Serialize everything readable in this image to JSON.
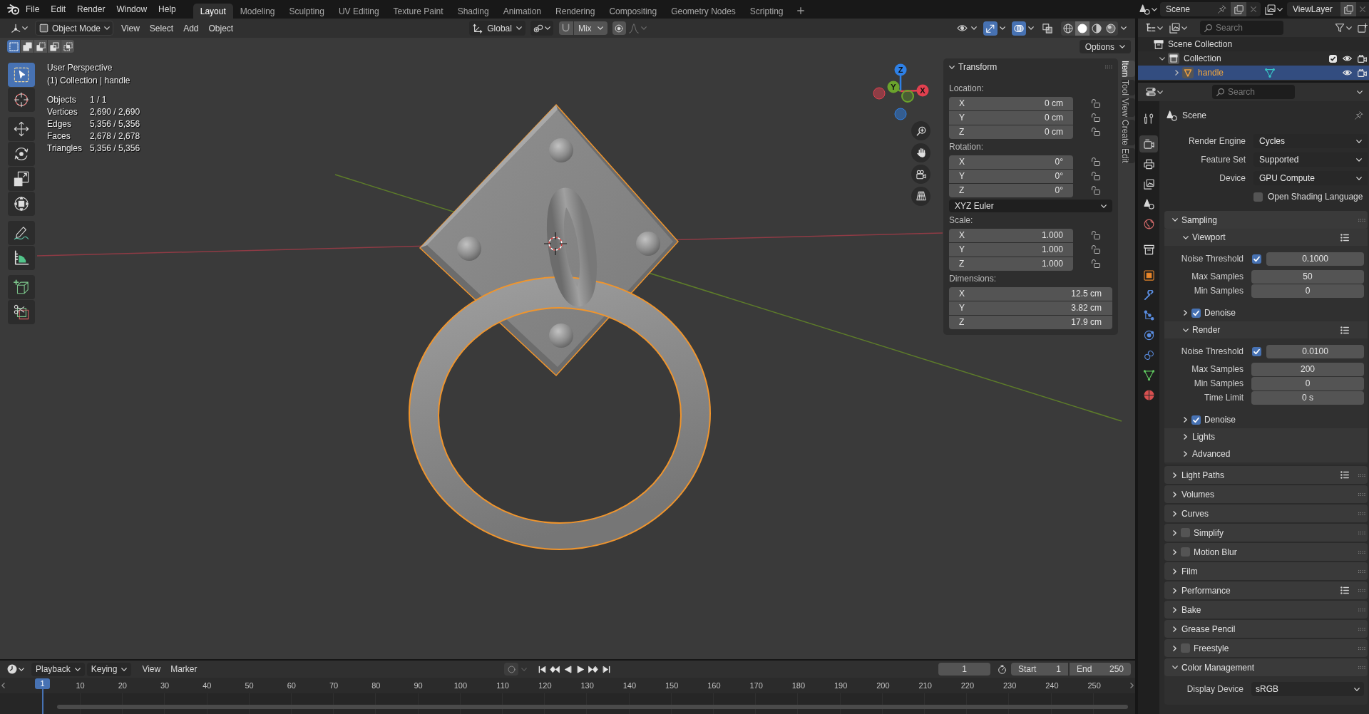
{
  "menu_bar": {
    "menus": [
      "File",
      "Edit",
      "Render",
      "Window",
      "Help"
    ]
  },
  "workspaces": [
    {
      "label": "Layout",
      "selected": true
    },
    {
      "label": "Modeling",
      "selected": false
    },
    {
      "label": "Sculpting",
      "selected": false
    },
    {
      "label": "UV Editing",
      "selected": false
    },
    {
      "label": "Texture Paint",
      "selected": false
    },
    {
      "label": "Shading",
      "selected": false
    },
    {
      "label": "Animation",
      "selected": false
    },
    {
      "label": "Rendering",
      "selected": false
    },
    {
      "label": "Compositing",
      "selected": false
    },
    {
      "label": "Geometry Nodes",
      "selected": false
    },
    {
      "label": "Scripting",
      "selected": false
    }
  ],
  "scene_selector": {
    "name": "Scene"
  },
  "view_layer_selector": {
    "name": "ViewLayer"
  },
  "viewport": {
    "header": {
      "mode": "Object Mode",
      "menus": [
        "View",
        "Select",
        "Add",
        "Object"
      ],
      "orientation": "Global",
      "snap_target": "Mix",
      "toggles": [
        {
          "kind": "visibility",
          "on": false
        },
        {
          "kind": "gizmos",
          "on": true
        },
        {
          "kind": "overlays",
          "on": true
        },
        {
          "kind": "xray",
          "on": false
        }
      ],
      "shading_modes": [
        {
          "kind": "wireframe",
          "selected": false
        },
        {
          "kind": "solid",
          "selected": true
        },
        {
          "kind": "material",
          "selected": false
        },
        {
          "kind": "rendered",
          "selected": false
        }
      ]
    },
    "select_modes": [
      {
        "kind": "set",
        "selected": true
      },
      {
        "kind": "extend",
        "selected": false
      },
      {
        "kind": "subtract",
        "selected": false
      },
      {
        "kind": "difference",
        "selected": false
      },
      {
        "kind": "intersect",
        "selected": false
      }
    ],
    "options_label": "Options",
    "info": {
      "view_name": "User Perspective",
      "context": "(1) Collection | handle"
    },
    "stats": [
      {
        "label": "Objects",
        "value": "1 / 1"
      },
      {
        "label": "Vertices",
        "value": "2,690 / 2,690"
      },
      {
        "label": "Edges",
        "value": "5,356 / 5,356"
      },
      {
        "label": "Faces",
        "value": "2,678 / 2,678"
      },
      {
        "label": "Triangles",
        "value": "5,356 / 5,356"
      }
    ],
    "tool_groups": [
      [
        {
          "kind": "select_box",
          "selected": true
        },
        {
          "kind": "cursor",
          "selected": false
        }
      ],
      [
        {
          "kind": "move",
          "selected": false
        },
        {
          "kind": "rotate",
          "selected": false
        },
        {
          "kind": "scale",
          "selected": false
        },
        {
          "kind": "transform",
          "selected": false
        }
      ],
      [
        {
          "kind": "annotate",
          "selected": false
        },
        {
          "kind": "measure",
          "selected": false
        }
      ],
      [
        {
          "kind": "add_cube",
          "selected": false
        },
        {
          "kind": "cut",
          "selected": false
        }
      ]
    ],
    "gizmo_axes": [
      {
        "label": "Z",
        "color": "#2e80e6"
      },
      {
        "label": "Y",
        "color": "#6ba42c"
      },
      {
        "label": "X",
        "color": "#e2404f"
      }
    ]
  },
  "sidebar": {
    "tabs": [
      {
        "label": "Item",
        "selected": true
      },
      {
        "label": "Tool",
        "selected": false
      },
      {
        "label": "View",
        "selected": false
      },
      {
        "label": "Create",
        "selected": false
      },
      {
        "label": "Edit",
        "selected": false
      }
    ],
    "panel": {
      "title": "Transform",
      "expanded": true,
      "sections": [
        {
          "kind": "vector",
          "label": "Location:",
          "rows": [
            {
              "axis": "X",
              "value": "0 cm",
              "locked": false
            },
            {
              "axis": "Y",
              "value": "0 cm",
              "locked": false
            },
            {
              "axis": "Z",
              "value": "0 cm",
              "locked": false
            }
          ]
        },
        {
          "kind": "vector",
          "label": "Rotation:",
          "rows": [
            {
              "axis": "X",
              "value": "0°",
              "locked": false
            },
            {
              "axis": "Y",
              "value": "0°",
              "locked": false
            },
            {
              "axis": "Z",
              "value": "0°",
              "locked": false
            }
          ]
        },
        {
          "kind": "dropdown",
          "value": "XYZ Euler"
        },
        {
          "kind": "vector",
          "label": "Scale:",
          "rows": [
            {
              "axis": "X",
              "value": "1.000",
              "locked": false
            },
            {
              "axis": "Y",
              "value": "1.000",
              "locked": false
            },
            {
              "axis": "Z",
              "value": "1.000",
              "locked": false
            }
          ]
        },
        {
          "kind": "vector",
          "label": "Dimensions:",
          "rows": [
            {
              "axis": "X",
              "value": "12.5 cm"
            },
            {
              "axis": "Y",
              "value": "3.82 cm"
            },
            {
              "axis": "Z",
              "value": "17.9 cm"
            }
          ]
        }
      ]
    }
  },
  "timeline": {
    "dropdowns": [
      "Playback",
      "Keying"
    ],
    "menus": [
      "View",
      "Marker"
    ],
    "current_frame": "1",
    "start_label": "Start",
    "start": "1",
    "end_label": "End",
    "end": "250",
    "playhead": "1",
    "ruler": [
      "10",
      "20",
      "30",
      "40",
      "50",
      "60",
      "70",
      "80",
      "90",
      "100",
      "110",
      "120",
      "130",
      "140",
      "150",
      "160",
      "170",
      "180",
      "190",
      "200",
      "210",
      "220",
      "230",
      "240",
      "250"
    ]
  },
  "outliner": {
    "search_placeholder": "Search",
    "items": [
      {
        "kind": "scene_collection",
        "label": "Scene Collection",
        "selected": false,
        "children": [
          {
            "kind": "collection",
            "label": "Collection",
            "selected": false,
            "expanded": true,
            "checked": true,
            "children": [
              {
                "kind": "mesh_object",
                "label": "handle",
                "selected": true,
                "expanded": false
              }
            ]
          }
        ]
      }
    ]
  },
  "properties": {
    "search_placeholder": "Search",
    "tabs": [
      {
        "kind": "tool",
        "selected": false
      },
      {
        "kind": "render",
        "selected": true
      },
      {
        "kind": "output",
        "selected": false
      },
      {
        "kind": "view_layer",
        "selected": false
      },
      {
        "kind": "scene",
        "selected": false
      },
      {
        "kind": "world",
        "selected": false
      },
      {
        "kind": "collection",
        "selected": false
      },
      {
        "kind": "object",
        "selected": false
      },
      {
        "kind": "modifiers",
        "selected": false
      },
      {
        "kind": "particles",
        "selected": false
      },
      {
        "kind": "physics",
        "selected": false
      },
      {
        "kind": "constraints",
        "selected": false
      },
      {
        "kind": "data",
        "selected": false
      },
      {
        "kind": "material",
        "selected": false
      }
    ],
    "context": "Scene",
    "fields": [
      {
        "kind": "dropdown",
        "label": "Render Engine",
        "value": "Cycles"
      },
      {
        "kind": "dropdown",
        "label": "Feature Set",
        "value": "Supported"
      },
      {
        "kind": "dropdown",
        "label": "Device",
        "value": "GPU Compute"
      },
      {
        "kind": "checkbox",
        "label": "Open Shading Language",
        "checked": false
      }
    ],
    "panels": [
      {
        "title": "Sampling",
        "expanded": true,
        "children": [
          {
            "title": "Viewport",
            "expanded": true,
            "presets": true,
            "rows": [
              {
                "kind": "toggle_number",
                "label": "Noise Threshold",
                "checked": true,
                "value": "0.1000"
              },
              {
                "kind": "number",
                "label": "Max Samples",
                "value": "50"
              },
              {
                "kind": "number",
                "label": "Min Samples",
                "value": "0"
              }
            ],
            "children": [
              {
                "title": "Denoise",
                "expanded": false,
                "checked": true
              }
            ]
          },
          {
            "title": "Render",
            "expanded": true,
            "presets": true,
            "rows": [
              {
                "kind": "toggle_number",
                "label": "Noise Threshold",
                "checked": true,
                "value": "0.0100"
              },
              {
                "kind": "number",
                "label": "Max Samples",
                "value": "200"
              },
              {
                "kind": "number",
                "label": "Min Samples",
                "value": "0"
              },
              {
                "kind": "number",
                "label": "Time Limit",
                "value": "0 s"
              }
            ],
            "children": [
              {
                "title": "Denoise",
                "expanded": false,
                "checked": true
              }
            ]
          },
          {
            "title": "Lights",
            "expanded": false
          },
          {
            "title": "Advanced",
            "expanded": false
          }
        ]
      },
      {
        "title": "Light Paths",
        "expanded": false,
        "presets": true
      },
      {
        "title": "Volumes",
        "expanded": false
      },
      {
        "title": "Curves",
        "expanded": false
      },
      {
        "title": "Simplify",
        "expanded": false,
        "checked": false
      },
      {
        "title": "Motion Blur",
        "expanded": false,
        "checked": false
      },
      {
        "title": "Film",
        "expanded": false
      },
      {
        "title": "Performance",
        "expanded": false,
        "presets": true
      },
      {
        "title": "Bake",
        "expanded": false
      },
      {
        "title": "Grease Pencil",
        "expanded": false
      },
      {
        "title": "Freestyle",
        "expanded": false,
        "checked": false
      },
      {
        "title": "Color Management",
        "expanded": true,
        "rows": [
          {
            "kind": "dropdown",
            "label": "Display Device",
            "value": "sRGB"
          }
        ]
      }
    ]
  }
}
